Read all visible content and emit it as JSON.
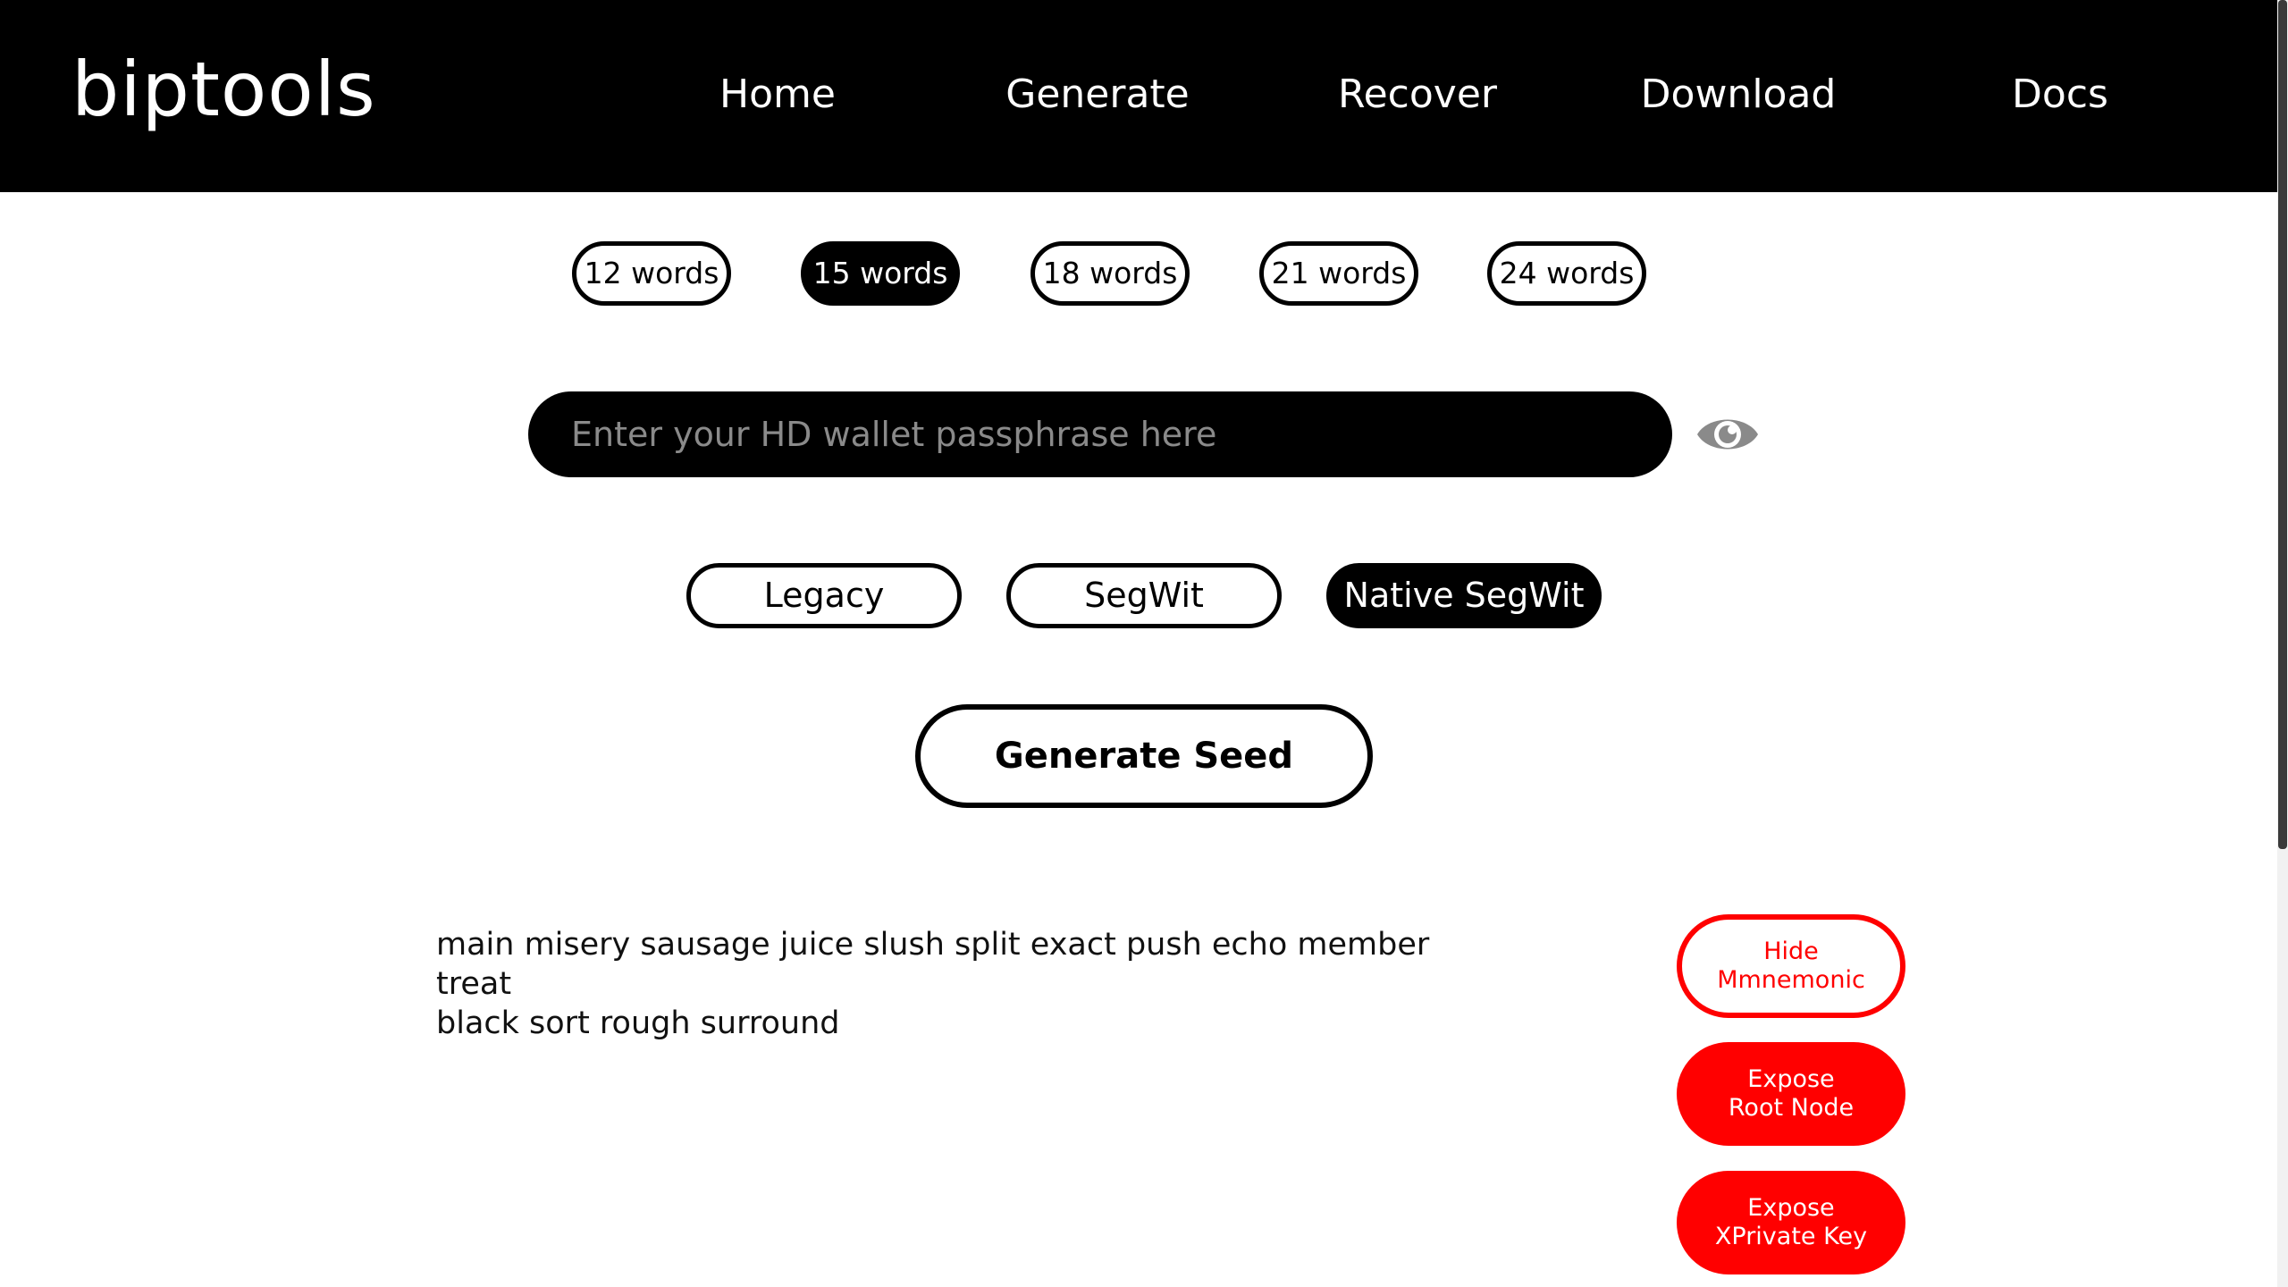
{
  "header": {
    "logo": "biptools",
    "nav": [
      {
        "label": "Home"
      },
      {
        "label": "Generate"
      },
      {
        "label": "Recover"
      },
      {
        "label": "Download"
      },
      {
        "label": "Docs"
      }
    ]
  },
  "word_counts": {
    "options": [
      "12 words",
      "15 words",
      "18 words",
      "21 words",
      "24 words"
    ],
    "selected": "15 words"
  },
  "passphrase": {
    "value": "",
    "placeholder": "Enter your HD wallet passphrase here",
    "toggle_icon": "eye-icon"
  },
  "address_types": {
    "options": [
      "Legacy",
      "SegWit",
      "Native SegWit"
    ],
    "selected": "Native SegWit"
  },
  "generate_button": {
    "label": "Generate Seed"
  },
  "mnemonic": {
    "line1": "main misery sausage juice slush split exact push echo member treat",
    "line2": "black sort rough surround"
  },
  "actions": {
    "hide_mnemonic": {
      "line1": "Hide",
      "line2": "Mmnemonic"
    },
    "expose_root": {
      "line1": "Expose",
      "line2": "Root Node"
    },
    "expose_xprv": {
      "line1": "Expose",
      "line2": "XPrivate Key"
    }
  },
  "colors": {
    "header_bg": "#000000",
    "accent_red": "#ff0000",
    "placeholder_gray": "#8a8a8a"
  }
}
